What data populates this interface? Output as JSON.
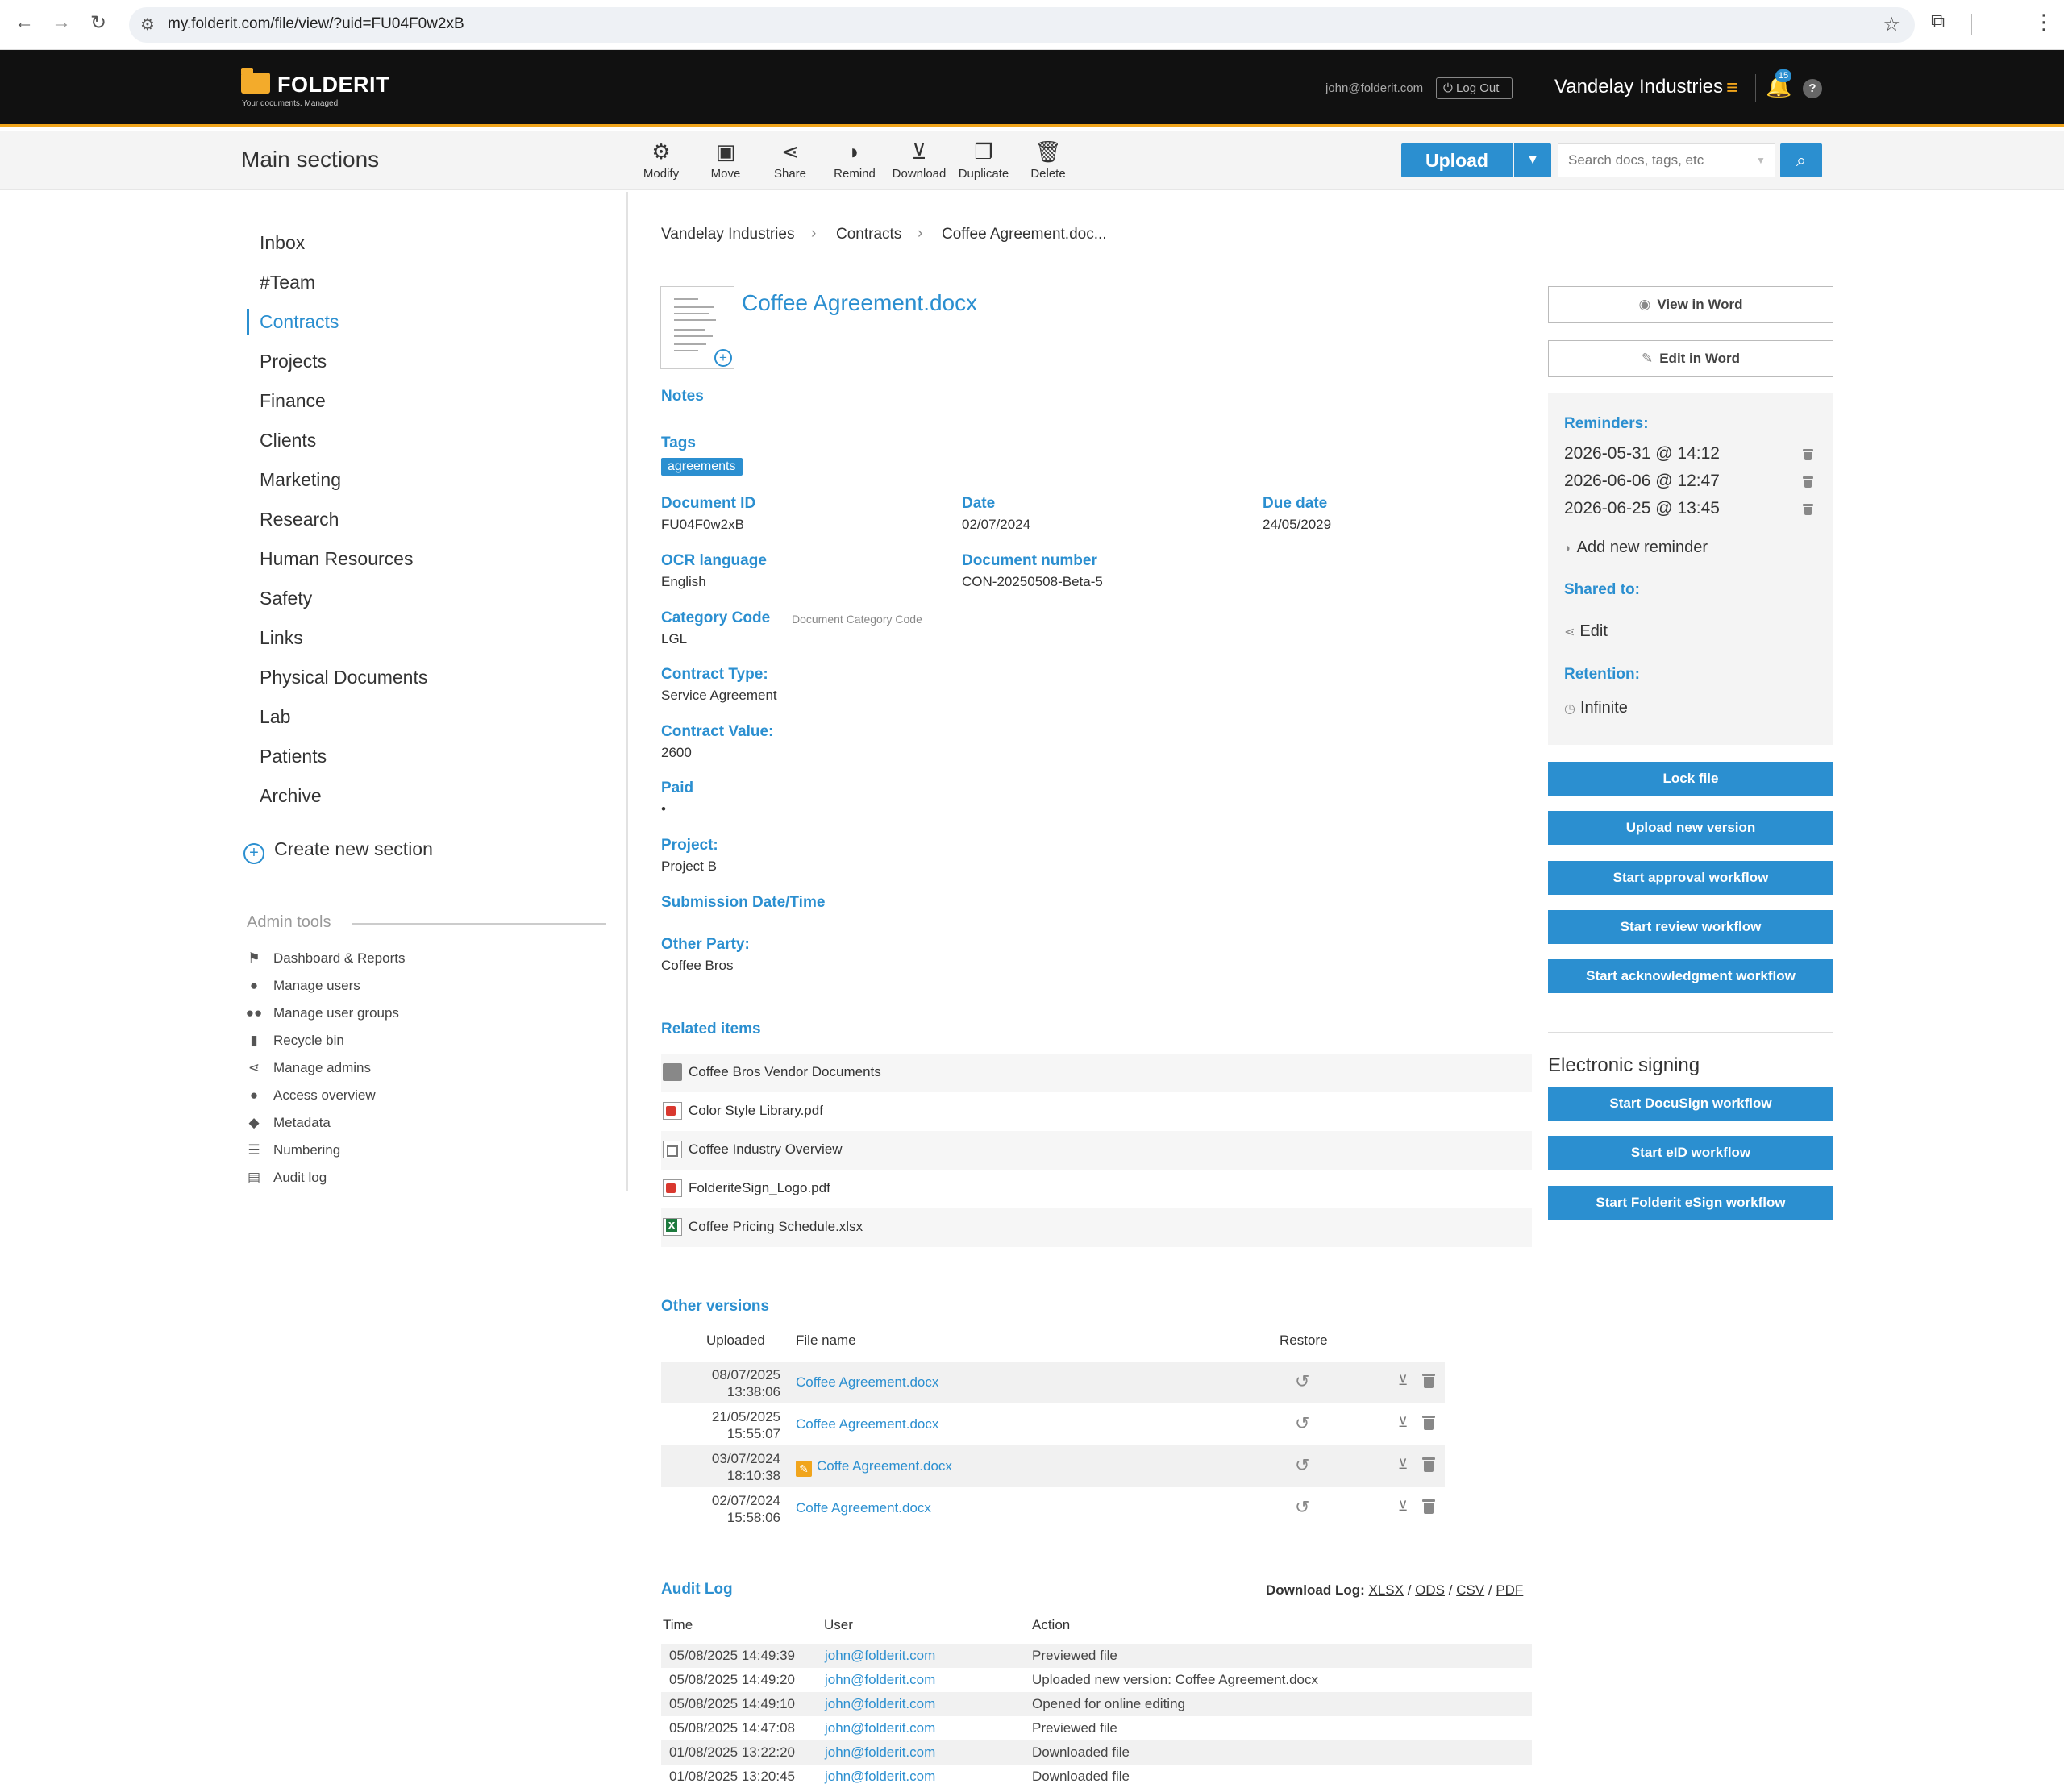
{
  "browser": {
    "url": "my.folderit.com/file/view/?uid=FU04F0w2xB"
  },
  "header": {
    "logo_text": "FOLDERIT",
    "logo_tagline": "Your documents. Managed.",
    "user_email": "john@folderit.com",
    "logout_label": "Log Out",
    "company": "Vandelay Industries",
    "notification_count": "15",
    "help_label": "?"
  },
  "toolbar": {
    "section_title": "Main sections",
    "tools": [
      {
        "label": "Modify",
        "icon": "gear-icon"
      },
      {
        "label": "Move",
        "icon": "move-box-icon"
      },
      {
        "label": "Share",
        "icon": "share-icon"
      },
      {
        "label": "Remind",
        "icon": "bell-icon"
      },
      {
        "label": "Download",
        "icon": "download-tray-icon"
      },
      {
        "label": "Duplicate",
        "icon": "duplicate-icon"
      },
      {
        "label": "Delete",
        "icon": "trash-icon"
      }
    ],
    "upload_label": "Upload",
    "search_placeholder": "Search docs, tags, etc"
  },
  "sidebar": {
    "items": [
      {
        "label": "Inbox",
        "active": false
      },
      {
        "label": "#Team",
        "active": false
      },
      {
        "label": "Contracts",
        "active": true
      },
      {
        "label": "Projects",
        "active": false
      },
      {
        "label": "Finance",
        "active": false
      },
      {
        "label": "Clients",
        "active": false
      },
      {
        "label": "Marketing",
        "active": false
      },
      {
        "label": "Research",
        "active": false
      },
      {
        "label": "Human Resources",
        "active": false
      },
      {
        "label": "Safety",
        "active": false
      },
      {
        "label": "Links",
        "active": false
      },
      {
        "label": "Physical Documents",
        "active": false
      },
      {
        "label": "Lab",
        "active": false
      },
      {
        "label": "Patients",
        "active": false
      },
      {
        "label": "Archive",
        "active": false
      }
    ],
    "create_label": "Create new section",
    "admin_title": "Admin tools",
    "admin_items": [
      {
        "label": "Dashboard & Reports",
        "icon": "flag-icon"
      },
      {
        "label": "Manage users",
        "icon": "user-icon"
      },
      {
        "label": "Manage user groups",
        "icon": "users-icon"
      },
      {
        "label": "Recycle bin",
        "icon": "trash-icon"
      },
      {
        "label": "Manage admins",
        "icon": "share-icon"
      },
      {
        "label": "Access overview",
        "icon": "user-icon"
      },
      {
        "label": "Metadata",
        "icon": "tag-icon"
      },
      {
        "label": "Numbering",
        "icon": "list-icon"
      },
      {
        "label": "Audit log",
        "icon": "document-icon"
      }
    ]
  },
  "breadcrumb": [
    "Vandelay Industries",
    "Contracts",
    "Coffee Agreement.doc..."
  ],
  "document": {
    "title": "Coffee Agreement.docx",
    "notes_label": "Notes",
    "tags_label": "Tags",
    "tags": [
      "agreements"
    ],
    "fields": {
      "document_id": {
        "label": "Document ID",
        "value": "FU04F0w2xB"
      },
      "date": {
        "label": "Date",
        "value": "02/07/2024"
      },
      "due_date": {
        "label": "Due date",
        "value": "24/05/2029"
      },
      "ocr_language": {
        "label": "OCR language",
        "value": "English"
      },
      "document_number": {
        "label": "Document number",
        "value": "CON-20250508-Beta-5"
      },
      "category_code": {
        "label": "Category Code",
        "hint": "Document Category Code",
        "value": "LGL"
      },
      "contract_type": {
        "label": "Contract Type:",
        "value": "Service Agreement"
      },
      "contract_value": {
        "label": "Contract Value:",
        "value": "2600"
      },
      "paid": {
        "label": "Paid",
        "value": "•"
      },
      "project": {
        "label": "Project:",
        "value": "Project B"
      },
      "submission": {
        "label": "Submission Date/Time",
        "value": ""
      },
      "other_party": {
        "label": "Other Party:",
        "value": "Coffee Bros"
      }
    }
  },
  "related": {
    "title": "Related items",
    "items": [
      {
        "name": "Coffee Bros Vendor Documents",
        "type": "folder"
      },
      {
        "name": "Color Style Library.pdf",
        "type": "pdf"
      },
      {
        "name": "Coffee Industry Overview",
        "type": "doc"
      },
      {
        "name": "FolderiteSign_Logo.pdf",
        "type": "pdf"
      },
      {
        "name": "Coffee Pricing Schedule.xlsx",
        "type": "xls"
      }
    ]
  },
  "versions": {
    "title": "Other versions",
    "headers": {
      "uploaded": "Uploaded",
      "file_name": "File name",
      "restore": "Restore"
    },
    "rows": [
      {
        "date": "08/07/2025",
        "time": "13:38:06",
        "name": "Coffee Agreement.docx",
        "edited": false
      },
      {
        "date": "21/05/2025",
        "time": "15:55:07",
        "name": "Coffee Agreement.docx",
        "edited": false
      },
      {
        "date": "03/07/2024",
        "time": "18:10:38",
        "name": "Coffe Agreement.docx",
        "edited": true
      },
      {
        "date": "02/07/2024",
        "time": "15:58:06",
        "name": "Coffe Agreement.docx",
        "edited": false
      }
    ]
  },
  "audit": {
    "title": "Audit Log",
    "download_label": "Download Log:",
    "formats": [
      "XLSX",
      "ODS",
      "CSV",
      "PDF"
    ],
    "headers": {
      "time": "Time",
      "user": "User",
      "action": "Action"
    },
    "rows": [
      {
        "time": "05/08/2025 14:49:39",
        "user": "john@folderit.com",
        "action": "Previewed file"
      },
      {
        "time": "05/08/2025 14:49:20",
        "user": "john@folderit.com",
        "action": "Uploaded new version: Coffee Agreement.docx"
      },
      {
        "time": "05/08/2025 14:49:10",
        "user": "john@folderit.com",
        "action": "Opened for online editing"
      },
      {
        "time": "05/08/2025 14:47:08",
        "user": "john@folderit.com",
        "action": "Previewed file"
      },
      {
        "time": "01/08/2025 13:22:20",
        "user": "john@folderit.com",
        "action": "Downloaded file"
      },
      {
        "time": "01/08/2025 13:20:45",
        "user": "john@folderit.com",
        "action": "Downloaded file"
      }
    ]
  },
  "right_panel": {
    "view_word": "View in Word",
    "edit_word": "Edit in Word",
    "reminders_label": "Reminders:",
    "reminders": [
      "2026-05-31 @ 14:12",
      "2026-06-06 @ 12:47",
      "2026-06-25 @ 13:45"
    ],
    "add_reminder": "Add new reminder",
    "shared_label": "Shared to:",
    "shared_value": "Edit",
    "retention_label": "Retention:",
    "retention_value": "Infinite",
    "actions": [
      "Lock file",
      "Upload new version",
      "Start approval workflow",
      "Start review workflow",
      "Start acknowledgment workflow"
    ],
    "esign_title": "Electronic signing",
    "esign_actions": [
      "Start DocuSign workflow",
      "Start eID workflow",
      "Start Folderit eSign workflow"
    ]
  },
  "colors": {
    "accent": "#2b8fd0",
    "brand": "#f1a51c",
    "header_bg": "#111111"
  }
}
